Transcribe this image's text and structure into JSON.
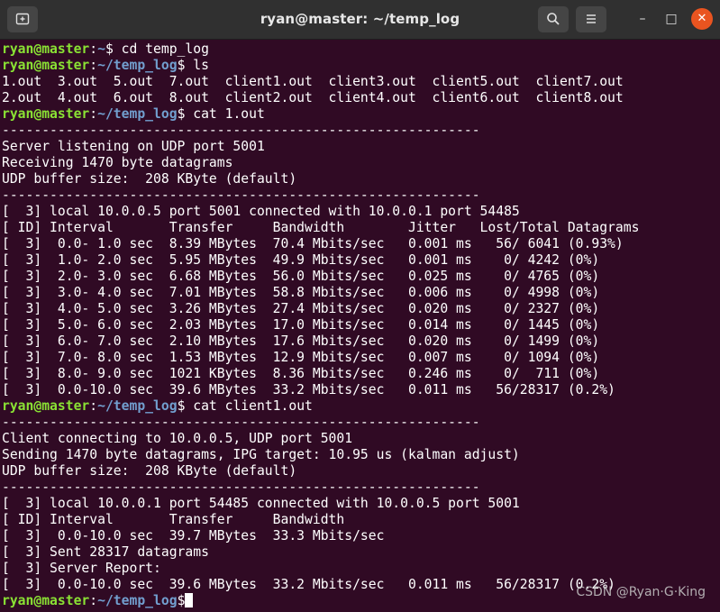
{
  "window": {
    "title": "ryan@master: ~/temp_log"
  },
  "titlebar": {
    "new_tab_icon": "new-tab-icon",
    "search_icon": "search-icon",
    "menu_icon": "hamburger-menu-icon",
    "minimize_glyph": "–",
    "maximize_glyph": "□",
    "close_glyph": "✕",
    "close_color": "#e95420"
  },
  "terminal": {
    "colors": {
      "background": "#300a24",
      "user": "#8ae234",
      "path": "#729fcf",
      "text": "#ffffff"
    },
    "prompt_user": "ryan@master",
    "prompt_home_path": "~",
    "prompt_path": "~/temp_log",
    "lines": [
      {
        "type": "prompt",
        "path": "~",
        "cmd": " cd temp_log"
      },
      {
        "type": "prompt",
        "path": "~/temp_log",
        "cmd": " ls"
      },
      {
        "type": "out",
        "text": "1.out  3.out  5.out  7.out  client1.out  client3.out  client5.out  client7.out"
      },
      {
        "type": "out",
        "text": "2.out  4.out  6.out  8.out  client2.out  client4.out  client6.out  client8.out"
      },
      {
        "type": "prompt",
        "path": "~/temp_log",
        "cmd": " cat 1.out"
      },
      {
        "type": "out",
        "text": "------------------------------------------------------------"
      },
      {
        "type": "out",
        "text": "Server listening on UDP port 5001"
      },
      {
        "type": "out",
        "text": "Receiving 1470 byte datagrams"
      },
      {
        "type": "out",
        "text": "UDP buffer size:  208 KByte (default)"
      },
      {
        "type": "out",
        "text": "------------------------------------------------------------"
      },
      {
        "type": "out",
        "text": "[  3] local 10.0.0.5 port 5001 connected with 10.0.0.1 port 54485"
      },
      {
        "type": "out",
        "text": "[ ID] Interval       Transfer     Bandwidth        Jitter   Lost/Total Datagrams"
      },
      {
        "type": "out",
        "text": "[  3]  0.0- 1.0 sec  8.39 MBytes  70.4 Mbits/sec   0.001 ms   56/ 6041 (0.93%)"
      },
      {
        "type": "out",
        "text": "[  3]  1.0- 2.0 sec  5.95 MBytes  49.9 Mbits/sec   0.001 ms    0/ 4242 (0%)"
      },
      {
        "type": "out",
        "text": "[  3]  2.0- 3.0 sec  6.68 MBytes  56.0 Mbits/sec   0.025 ms    0/ 4765 (0%)"
      },
      {
        "type": "out",
        "text": "[  3]  3.0- 4.0 sec  7.01 MBytes  58.8 Mbits/sec   0.006 ms    0/ 4998 (0%)"
      },
      {
        "type": "out",
        "text": "[  3]  4.0- 5.0 sec  3.26 MBytes  27.4 Mbits/sec   0.020 ms    0/ 2327 (0%)"
      },
      {
        "type": "out",
        "text": "[  3]  5.0- 6.0 sec  2.03 MBytes  17.0 Mbits/sec   0.014 ms    0/ 1445 (0%)"
      },
      {
        "type": "out",
        "text": "[  3]  6.0- 7.0 sec  2.10 MBytes  17.6 Mbits/sec   0.020 ms    0/ 1499 (0%)"
      },
      {
        "type": "out",
        "text": "[  3]  7.0- 8.0 sec  1.53 MBytes  12.9 Mbits/sec   0.007 ms    0/ 1094 (0%)"
      },
      {
        "type": "out",
        "text": "[  3]  8.0- 9.0 sec  1021 KBytes  8.36 Mbits/sec   0.246 ms    0/  711 (0%)"
      },
      {
        "type": "out",
        "text": "[  3]  0.0-10.0 sec  39.6 MBytes  33.2 Mbits/sec   0.011 ms   56/28317 (0.2%)"
      },
      {
        "type": "prompt",
        "path": "~/temp_log",
        "cmd": " cat client1.out"
      },
      {
        "type": "out",
        "text": "------------------------------------------------------------"
      },
      {
        "type": "out",
        "text": "Client connecting to 10.0.0.5, UDP port 5001"
      },
      {
        "type": "out",
        "text": "Sending 1470 byte datagrams, IPG target: 10.95 us (kalman adjust)"
      },
      {
        "type": "out",
        "text": "UDP buffer size:  208 KByte (default)"
      },
      {
        "type": "out",
        "text": "------------------------------------------------------------"
      },
      {
        "type": "out",
        "text": "[  3] local 10.0.0.1 port 54485 connected with 10.0.0.5 port 5001"
      },
      {
        "type": "out",
        "text": "[ ID] Interval       Transfer     Bandwidth"
      },
      {
        "type": "out",
        "text": "[  3]  0.0-10.0 sec  39.7 MBytes  33.3 Mbits/sec"
      },
      {
        "type": "out",
        "text": "[  3] Sent 28317 datagrams"
      },
      {
        "type": "out",
        "text": "[  3] Server Report:"
      },
      {
        "type": "out",
        "text": "[  3]  0.0-10.0 sec  39.6 MBytes  33.2 Mbits/sec   0.011 ms   56/28317 (0.2%)"
      },
      {
        "type": "prompt",
        "path": "~/temp_log",
        "cmd": "",
        "cursor": true
      }
    ]
  },
  "watermark": "CSDN @Ryan·G·King"
}
